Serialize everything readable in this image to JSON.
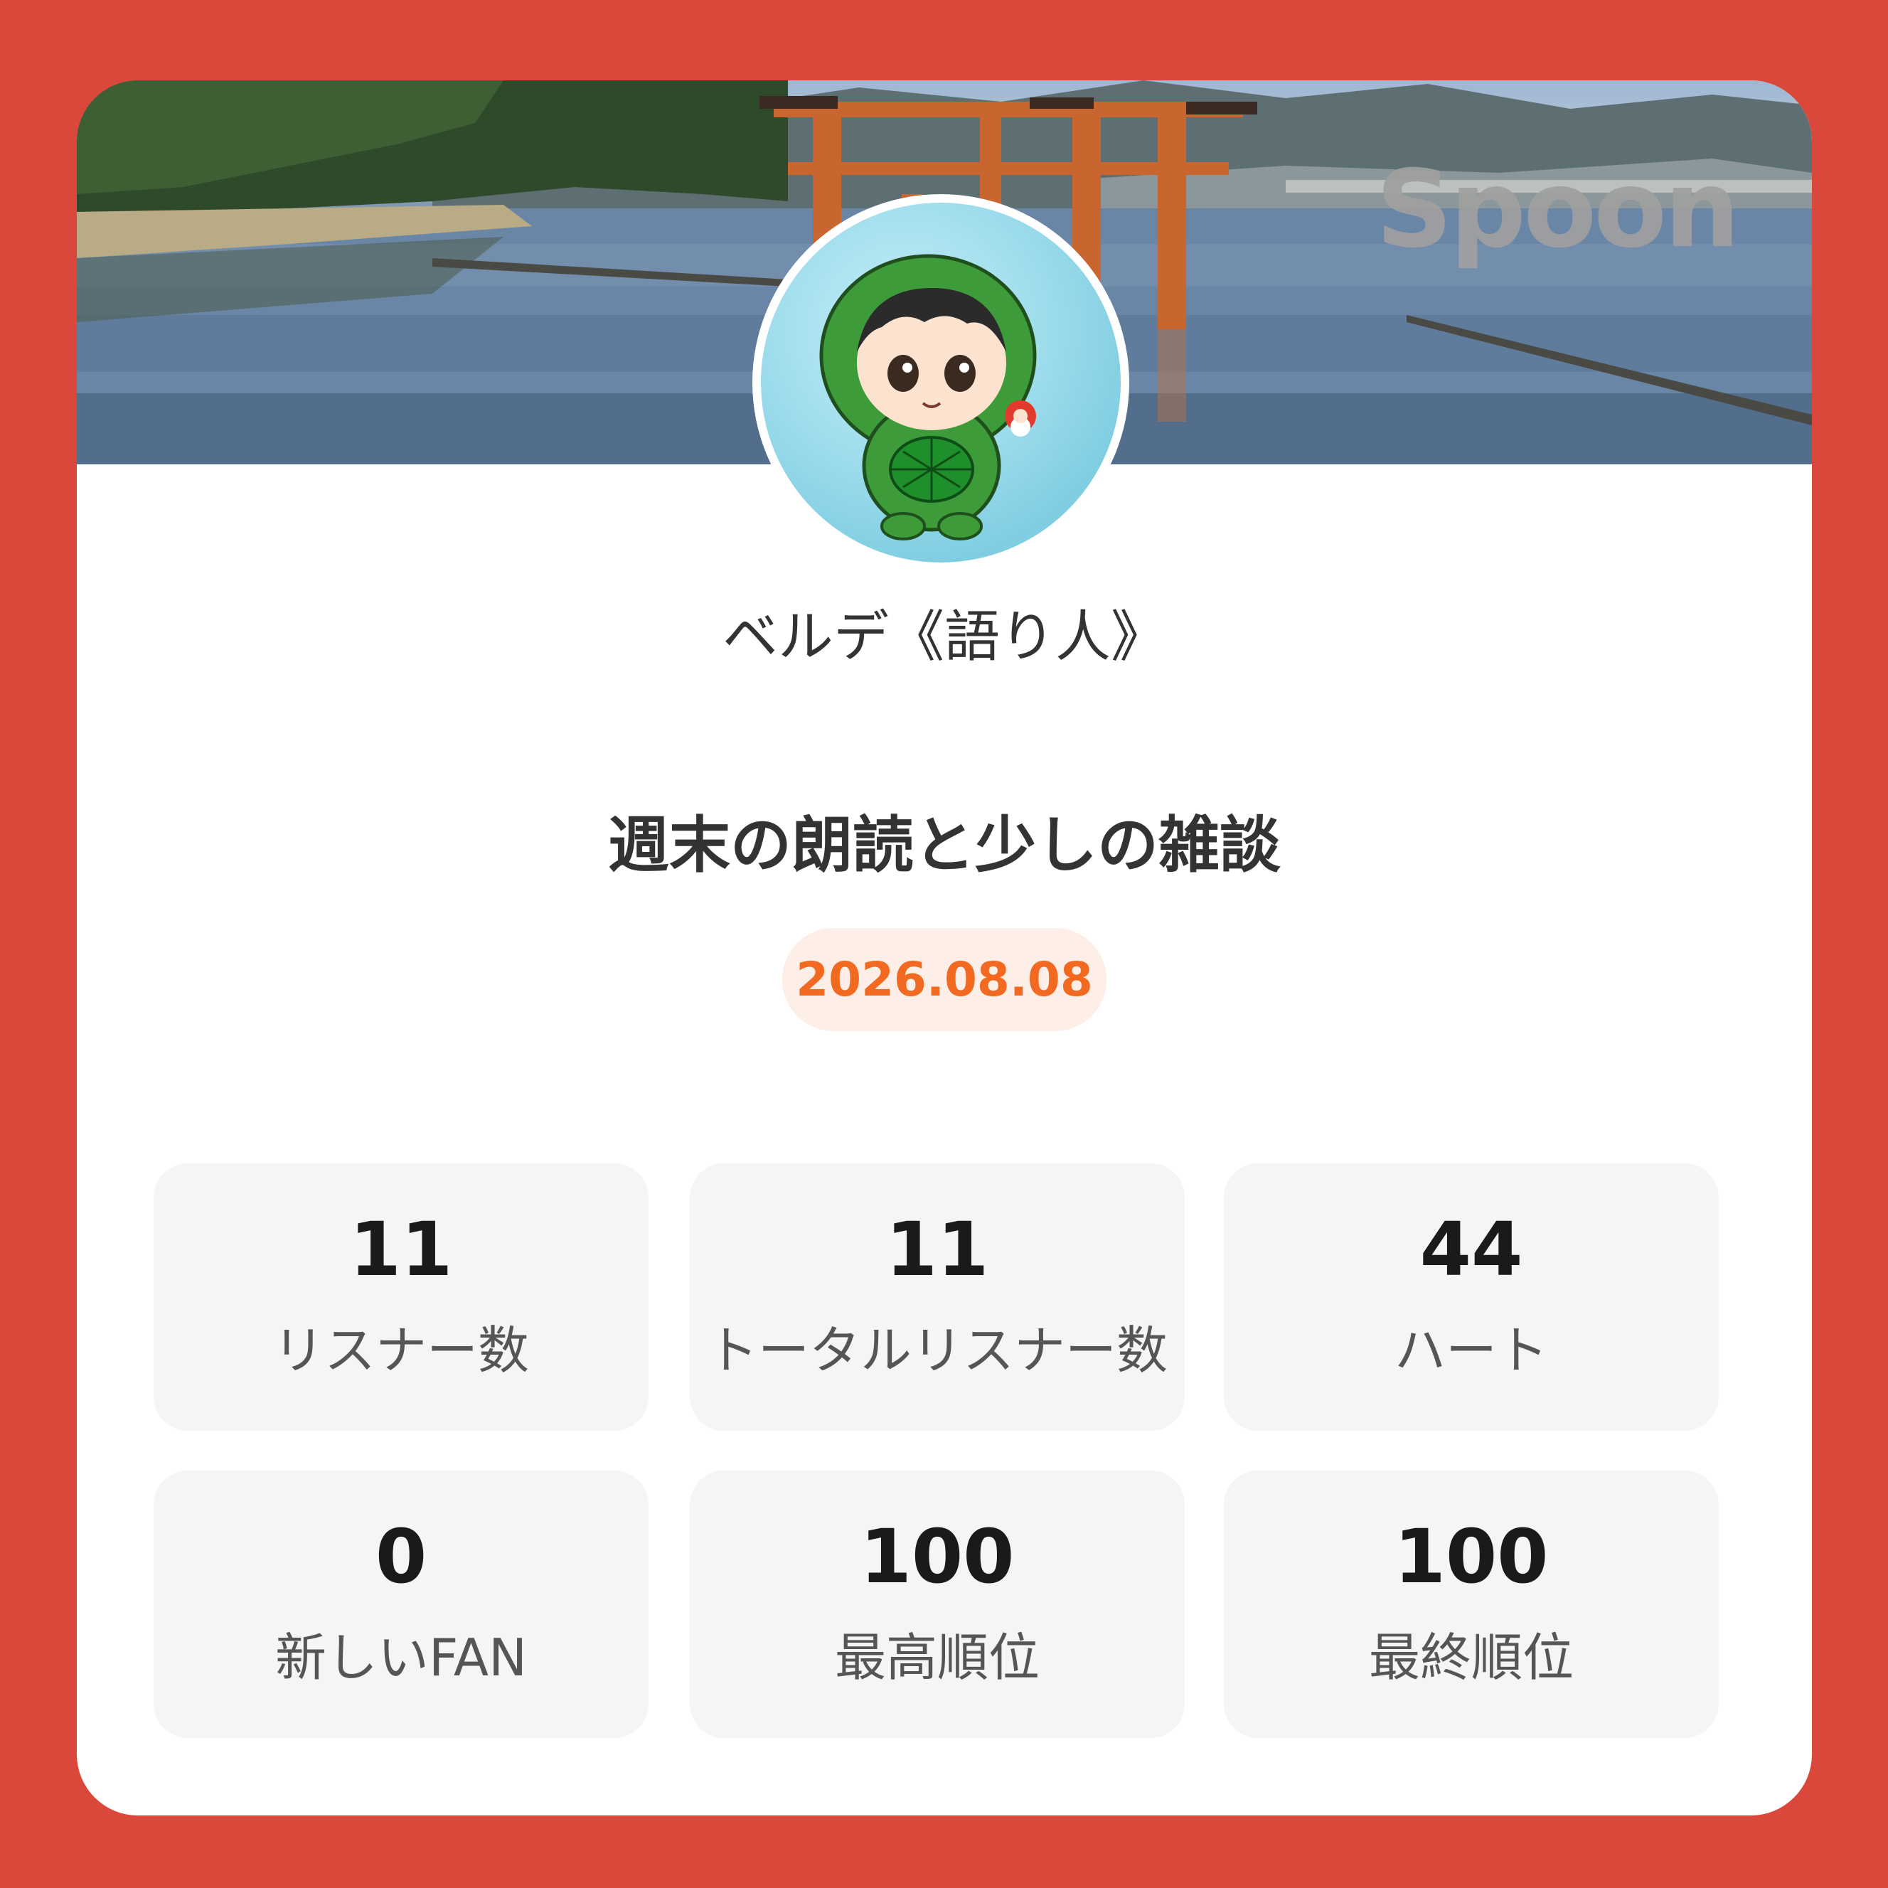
{
  "brand": {
    "logo_text": "Spoon"
  },
  "profile": {
    "username": "ベルデ《語り人》"
  },
  "broadcast": {
    "title": "週末の朗読と少しの雑談",
    "date": "2026.08.08"
  },
  "stats": [
    {
      "value": "11",
      "label": "リスナー数"
    },
    {
      "value": "11",
      "label": "トータルリスナー数"
    },
    {
      "value": "44",
      "label": "ハート"
    },
    {
      "value": "0",
      "label": "新しいFAN"
    },
    {
      "value": "100",
      "label": "最高順位"
    },
    {
      "value": "100",
      "label": "最終順位"
    }
  ],
  "colors": {
    "background": "#d9483b",
    "accent": "#f26a22",
    "badge_bg": "#fdeee7"
  }
}
